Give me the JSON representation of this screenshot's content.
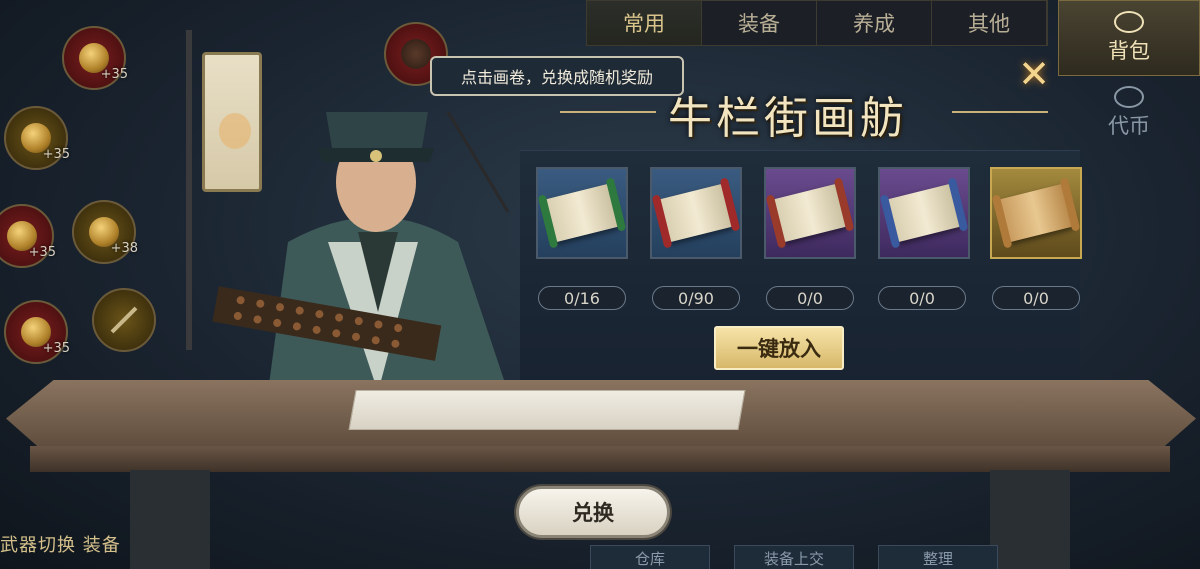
{
  "tabs": [
    "常用",
    "装备",
    "养成",
    "其他"
  ],
  "side_tabs": {
    "bag": {
      "label": "背包",
      "icon": "bag-icon"
    },
    "token": {
      "label": "代币",
      "icon": "token-icon"
    }
  },
  "title": "牛栏街画舫",
  "hint": "点击画卷，兑换成随机奖励",
  "equipment_slots": [
    {
      "level": "+35",
      "icon": "bracelet-icon"
    },
    {
      "level": "+35",
      "icon": "ring-icon"
    },
    {
      "level": "+35",
      "icon": "necklace-icon"
    },
    {
      "level": "+38",
      "icon": "pendant-icon"
    },
    {
      "level": "+35",
      "icon": "amulet-icon"
    },
    {
      "level": "",
      "icon": "weapon-icon"
    }
  ],
  "scrolls": [
    {
      "count": "0/16",
      "rarity": "blue",
      "rod_color": "#2e7a3e",
      "icon": "green-scroll-icon"
    },
    {
      "count": "0/90",
      "rarity": "blue",
      "rod_color": "#a02a2a",
      "icon": "red-scroll-icon"
    },
    {
      "count": "0/0",
      "rarity": "purple",
      "rod_color": "#9a3a2a",
      "icon": "painting-scroll-icon"
    },
    {
      "count": "0/0",
      "rarity": "purple",
      "rod_color": "#3a5aa0",
      "icon": "blue-scroll-icon"
    },
    {
      "count": "0/0",
      "rarity": "gold",
      "rod_color": "#b07a3a",
      "icon": "gold-scroll-icon"
    }
  ],
  "buttons": {
    "one_click": "一键放入",
    "exchange": "兑换"
  },
  "bottom_left_text": "武器切换 装备",
  "bottom_tabs": [
    "仓库",
    "装备上交",
    "整理"
  ],
  "colors": {
    "accent_gold": "#d7b86a",
    "title_text": "#f1e4bf",
    "panel_bg": "#1f2c3a"
  }
}
